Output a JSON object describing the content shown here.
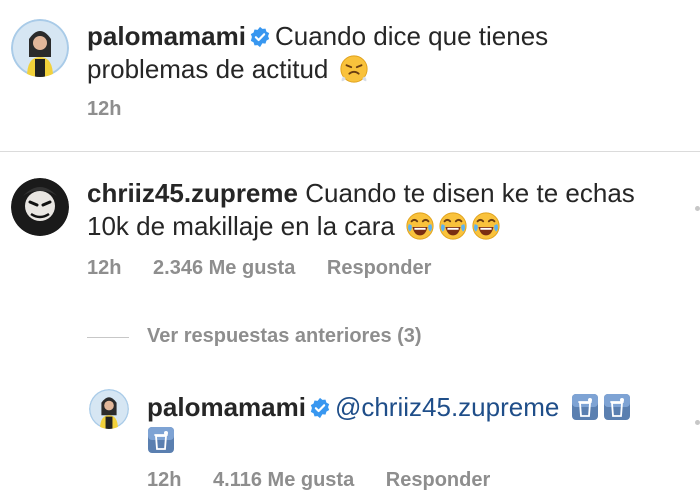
{
  "post": {
    "username": "palomamami",
    "caption": "Cuando dice que tienes",
    "caption_line2": "problemas de actitud",
    "caption_emoji": "huffing-face-emoji",
    "time": "12h"
  },
  "comment": {
    "username": "chriiz45.zupreme",
    "text_line1": "Cuando te disen ke te echas",
    "text_line2": "10k de makillaje en la cara",
    "emoji": "laughing-tears-emoji",
    "time": "12h",
    "likes": "2.346 Me gusta",
    "reply_label": "Responder"
  },
  "view_replies_label": "Ver respuestas anteriores (3)",
  "reply": {
    "username": "palomamami",
    "mention": "@chriiz45.zupreme",
    "emoji": "wastebasket-emoji",
    "time": "12h",
    "likes": "4.116 Me gusta",
    "reply_label": "Responder"
  },
  "colors": {
    "verified_badge": "#3897f0",
    "mention": "#1f4e89",
    "meta_text": "#8e8e8e"
  }
}
